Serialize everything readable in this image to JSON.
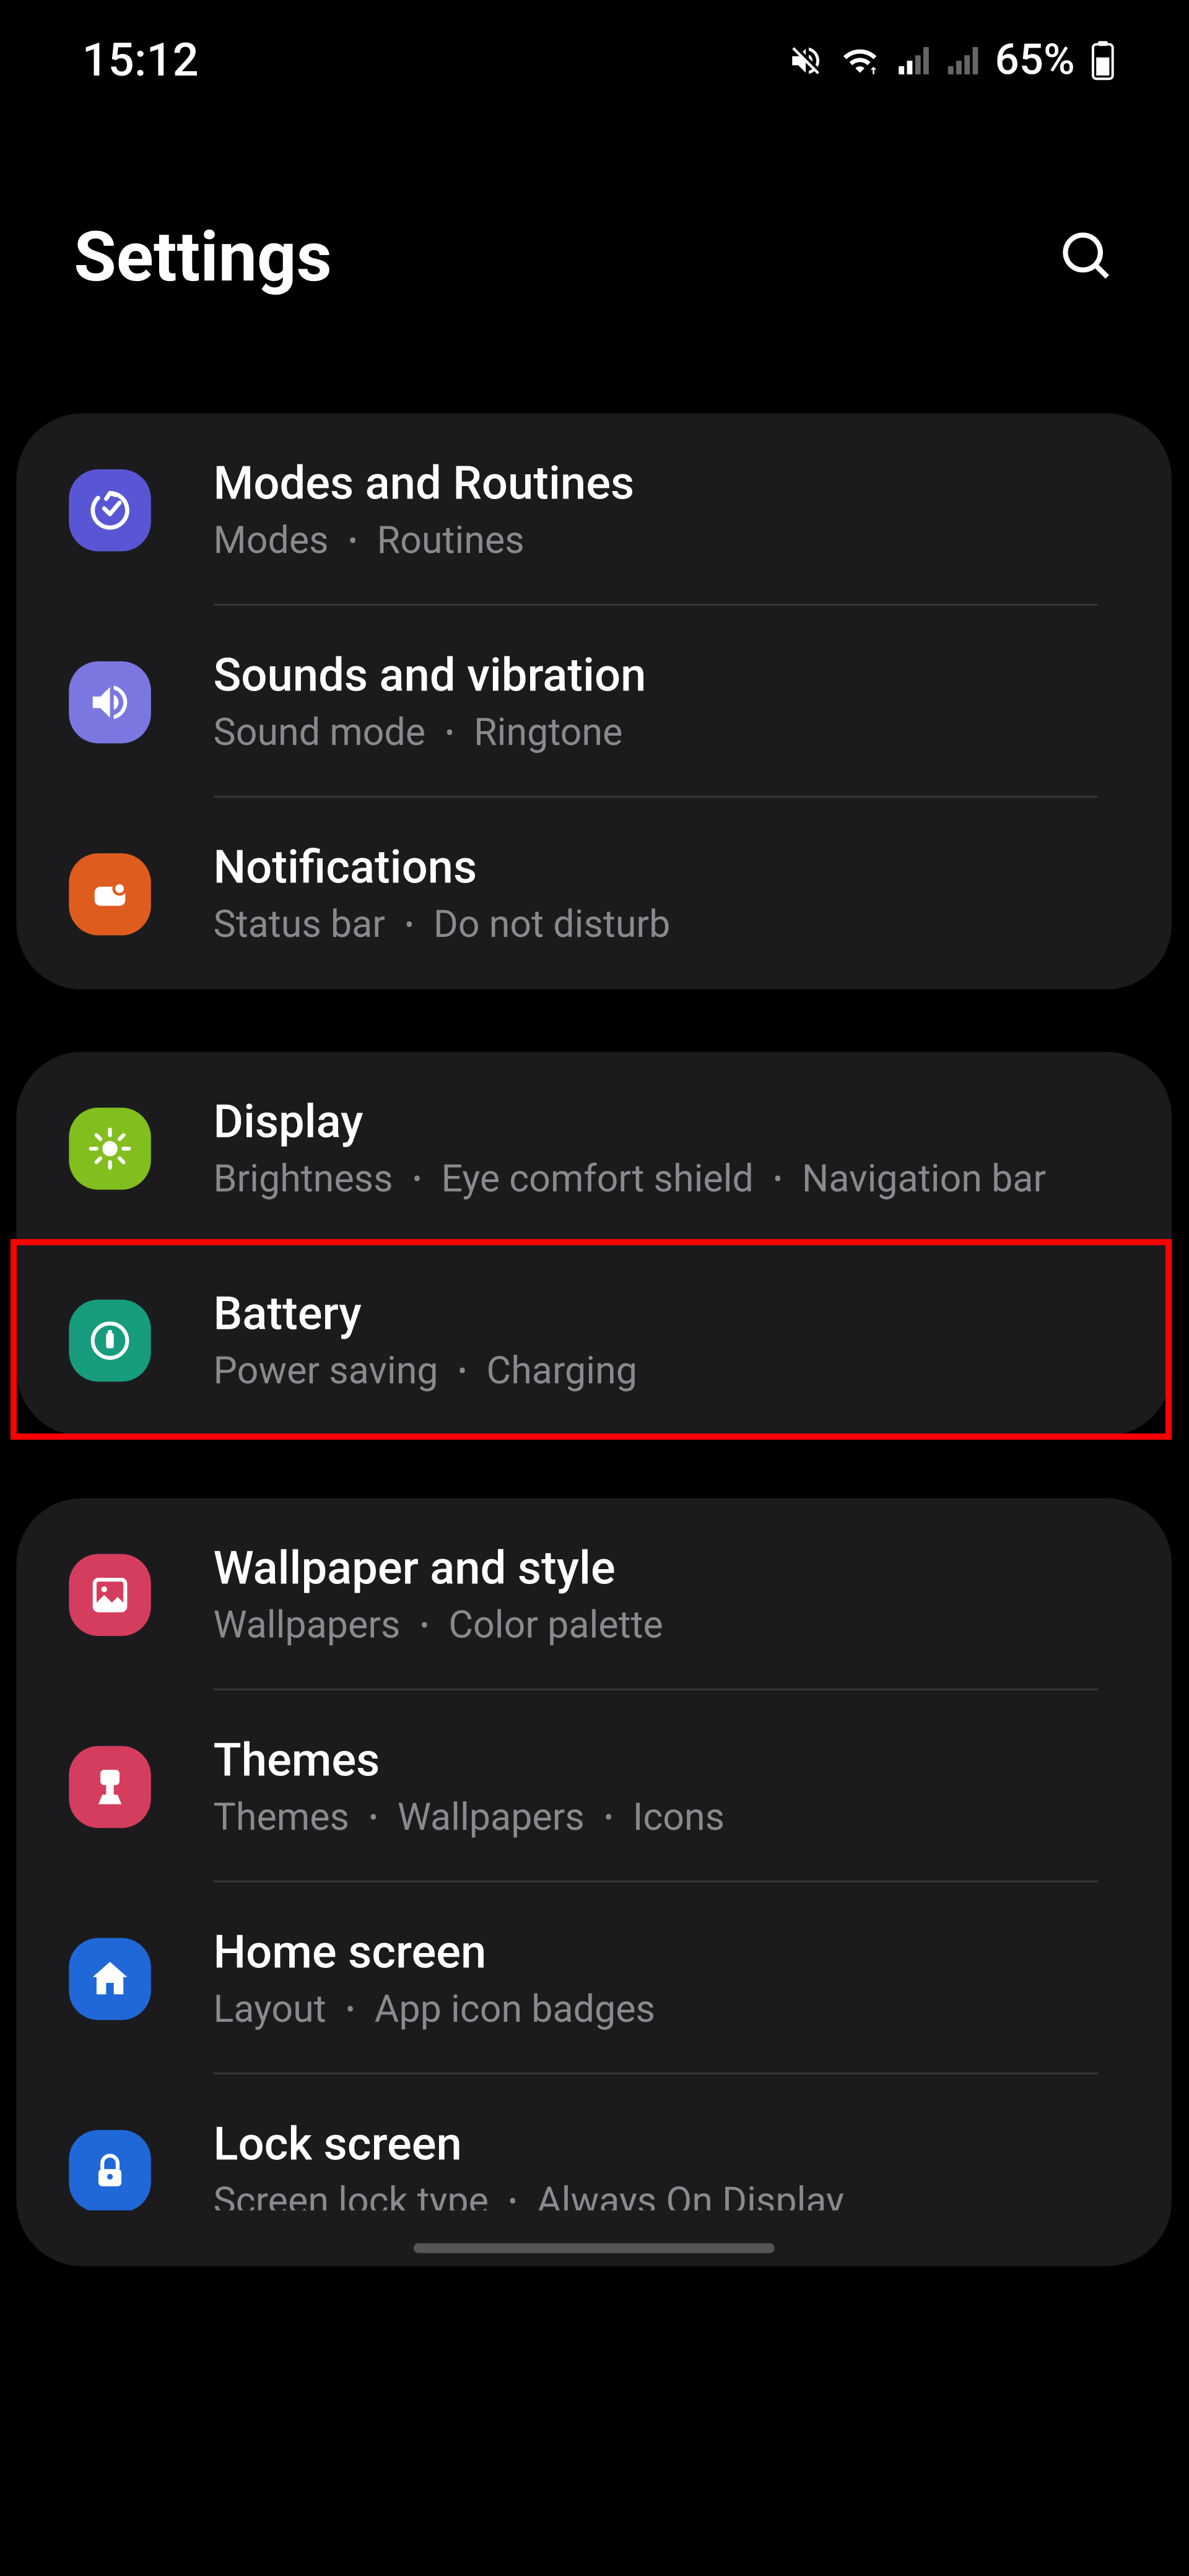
{
  "status": {
    "time": "15:12",
    "battery": "65%"
  },
  "header": {
    "title": "Settings"
  },
  "groups": [
    {
      "items": [
        {
          "title": "Modes and Routines",
          "subs": [
            "Modes",
            "Routines"
          ],
          "icon": "routines-icon",
          "color": "ic-purple"
        },
        {
          "title": "Sounds and vibration",
          "subs": [
            "Sound mode",
            "Ringtone"
          ],
          "icon": "sound-icon",
          "color": "ic-lpurple"
        },
        {
          "title": "Notifications",
          "subs": [
            "Status bar",
            "Do not disturb"
          ],
          "icon": "notifications-icon",
          "color": "ic-orange"
        }
      ]
    },
    {
      "items": [
        {
          "title": "Display",
          "subs": [
            "Brightness",
            "Eye comfort shield",
            "Navigation bar"
          ],
          "icon": "display-icon",
          "color": "ic-green"
        },
        {
          "title": "Battery",
          "subs": [
            "Power saving",
            "Charging"
          ],
          "icon": "battery-icon",
          "color": "ic-teal",
          "highlight": true
        }
      ]
    },
    {
      "items": [
        {
          "title": "Wallpaper and style",
          "subs": [
            "Wallpapers",
            "Color palette"
          ],
          "icon": "wallpaper-icon",
          "color": "ic-pink"
        },
        {
          "title": "Themes",
          "subs": [
            "Themes",
            "Wallpapers",
            "Icons"
          ],
          "icon": "themes-icon",
          "color": "ic-pink"
        },
        {
          "title": "Home screen",
          "subs": [
            "Layout",
            "App icon badges"
          ],
          "icon": "home-icon",
          "color": "ic-blue"
        },
        {
          "title": "Lock screen",
          "subs": [
            "Screen lock type",
            "Always On Display"
          ],
          "icon": "lock-icon",
          "color": "ic-blue"
        }
      ]
    }
  ]
}
